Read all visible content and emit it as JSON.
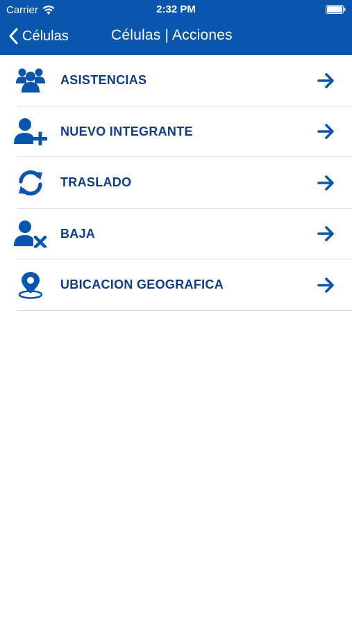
{
  "status_bar": {
    "carrier": "Carrier",
    "time": "2:32 PM"
  },
  "nav": {
    "back_label": "Células",
    "title": "Células | Acciones"
  },
  "menu": {
    "items": [
      {
        "label": "ASISTENCIAS",
        "icon": "users-group-icon"
      },
      {
        "label": "NUEVO INTEGRANTE",
        "icon": "user-plus-icon"
      },
      {
        "label": "TRASLADO",
        "icon": "refresh-icon"
      },
      {
        "label": "BAJA",
        "icon": "user-remove-icon"
      },
      {
        "label": "UBICACION GEOGRAFICA",
        "icon": "map-pin-icon"
      }
    ]
  },
  "colors": {
    "header": "#0a55ad",
    "label": "#0d3d8a",
    "icon": "#0a55ad",
    "divider": "#dcdcdc"
  }
}
